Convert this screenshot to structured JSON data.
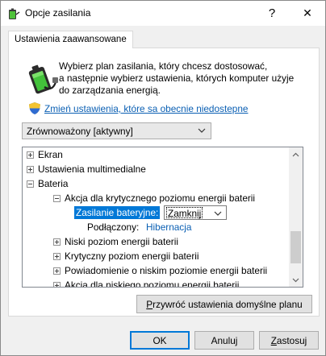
{
  "window": {
    "title": "Opcje zasilania",
    "help_button": "?",
    "close_button": "✕"
  },
  "tab": {
    "label": "Ustawienia zaawansowane"
  },
  "description": {
    "line1": "Wybierz plan zasilania, który chcesz dostosować,",
    "line2": "a następnie wybierz ustawienia, których komputer użyje",
    "line3": "do zarządzania energią."
  },
  "change_settings_link": "Zmień ustawienia, które sa obecnie niedostepne",
  "plan_select": {
    "value": "Zrównoważony [aktywny]"
  },
  "tree": {
    "items": [
      {
        "label": "Ekran",
        "expander": "plus"
      },
      {
        "label": "Ustawienia multimedialne",
        "expander": "plus"
      },
      {
        "label": "Bateria",
        "expander": "minus"
      },
      {
        "label": "Akcja dla krytycznego poziomu energii baterii",
        "expander": "minus"
      },
      {
        "label": "Niski poziom energii baterii",
        "expander": "plus"
      },
      {
        "label": "Krytyczny poziom energii baterii",
        "expander": "plus"
      },
      {
        "label": "Powiadomienie o niskim poziomie energii baterii",
        "expander": "plus"
      },
      {
        "label": "Akcja dla niskiego poziomu energii baterii",
        "expander": "plus"
      }
    ],
    "on_battery": {
      "label": "Zasilanie bateryjne:",
      "value": "Zamknij"
    },
    "plugged_in": {
      "label": "Podłączony:",
      "value": "Hibernacja"
    }
  },
  "buttons": {
    "restore_defaults": {
      "pre": "",
      "key": "P",
      "post": "rzywróć ustawienia domyślne planu"
    },
    "ok": "OK",
    "cancel": "Anuluj",
    "apply": {
      "pre": "",
      "key": "Z",
      "post": "astosuj"
    }
  },
  "colors": {
    "selection": "#0078d7",
    "link": "#0a5fb3",
    "dialog_bg": "#f0f0f0"
  },
  "icons": {
    "app": "battery-plug-icon",
    "battery": "battery-plug-icon",
    "shield": "uac-shield-icon"
  }
}
